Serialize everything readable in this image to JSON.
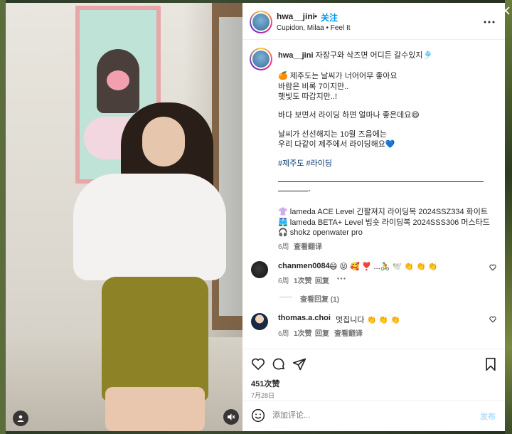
{
  "post": {
    "username": "hwa__jini",
    "dot": "•",
    "follow_label": "关注",
    "location": "Cupidon, Milaa • Feel It",
    "more_icon": "more-horizontal-icon"
  },
  "caption": {
    "username": "hwa__jini",
    "first_line": "자장구와 삭즈면 어디든 갈수있지🎐",
    "lines": [
      "🍊 제주도는 날씨가 너어어무 좋아요",
      "바람은 비록 7이지만..",
      "햇빛도 따갑지만..!",
      "바다 보면서 라이딩 하면 얼마나 좋은데요😄",
      "날씨가 선선해지는 10월 즈음에는",
      "우리 다같이 제주에서 라이딩해요💙"
    ],
    "hashtags": "#제주도 #라이딩",
    "divider_tail": "-",
    "products": [
      "👚 lameda ACE Level 긴팔져지 라이딩복 2024SSZ334 화이트",
      "🩳 lameda BETA+ Level 빕숏 라이딩복 2024SSS306 머스타드",
      "🎧 shokz openwater pro"
    ],
    "time": "6周",
    "translate": "查看翻译"
  },
  "comments": [
    {
      "username": "chanmen0084",
      "text": "😄 😝 🥰 ❣️ ...🚴 🕊️ 👏 👏 👏",
      "time": "6周",
      "likes": "1次赞",
      "reply": "回复",
      "replies_label": "查看回复 (1)"
    },
    {
      "username": "thomas.a.choi",
      "text": "멋집니다 👏 👏 👏",
      "time": "6周",
      "likes": "1次赞",
      "reply": "回复",
      "translate": "查看翻译"
    }
  ],
  "footer": {
    "likes": "451次赞",
    "date": "7月28日",
    "comment_placeholder": "添加评论...",
    "post_label": "发布"
  },
  "colors": {
    "accent": "#0095f6",
    "text": "#262626",
    "muted": "#737373",
    "hashtag": "#00376b"
  }
}
